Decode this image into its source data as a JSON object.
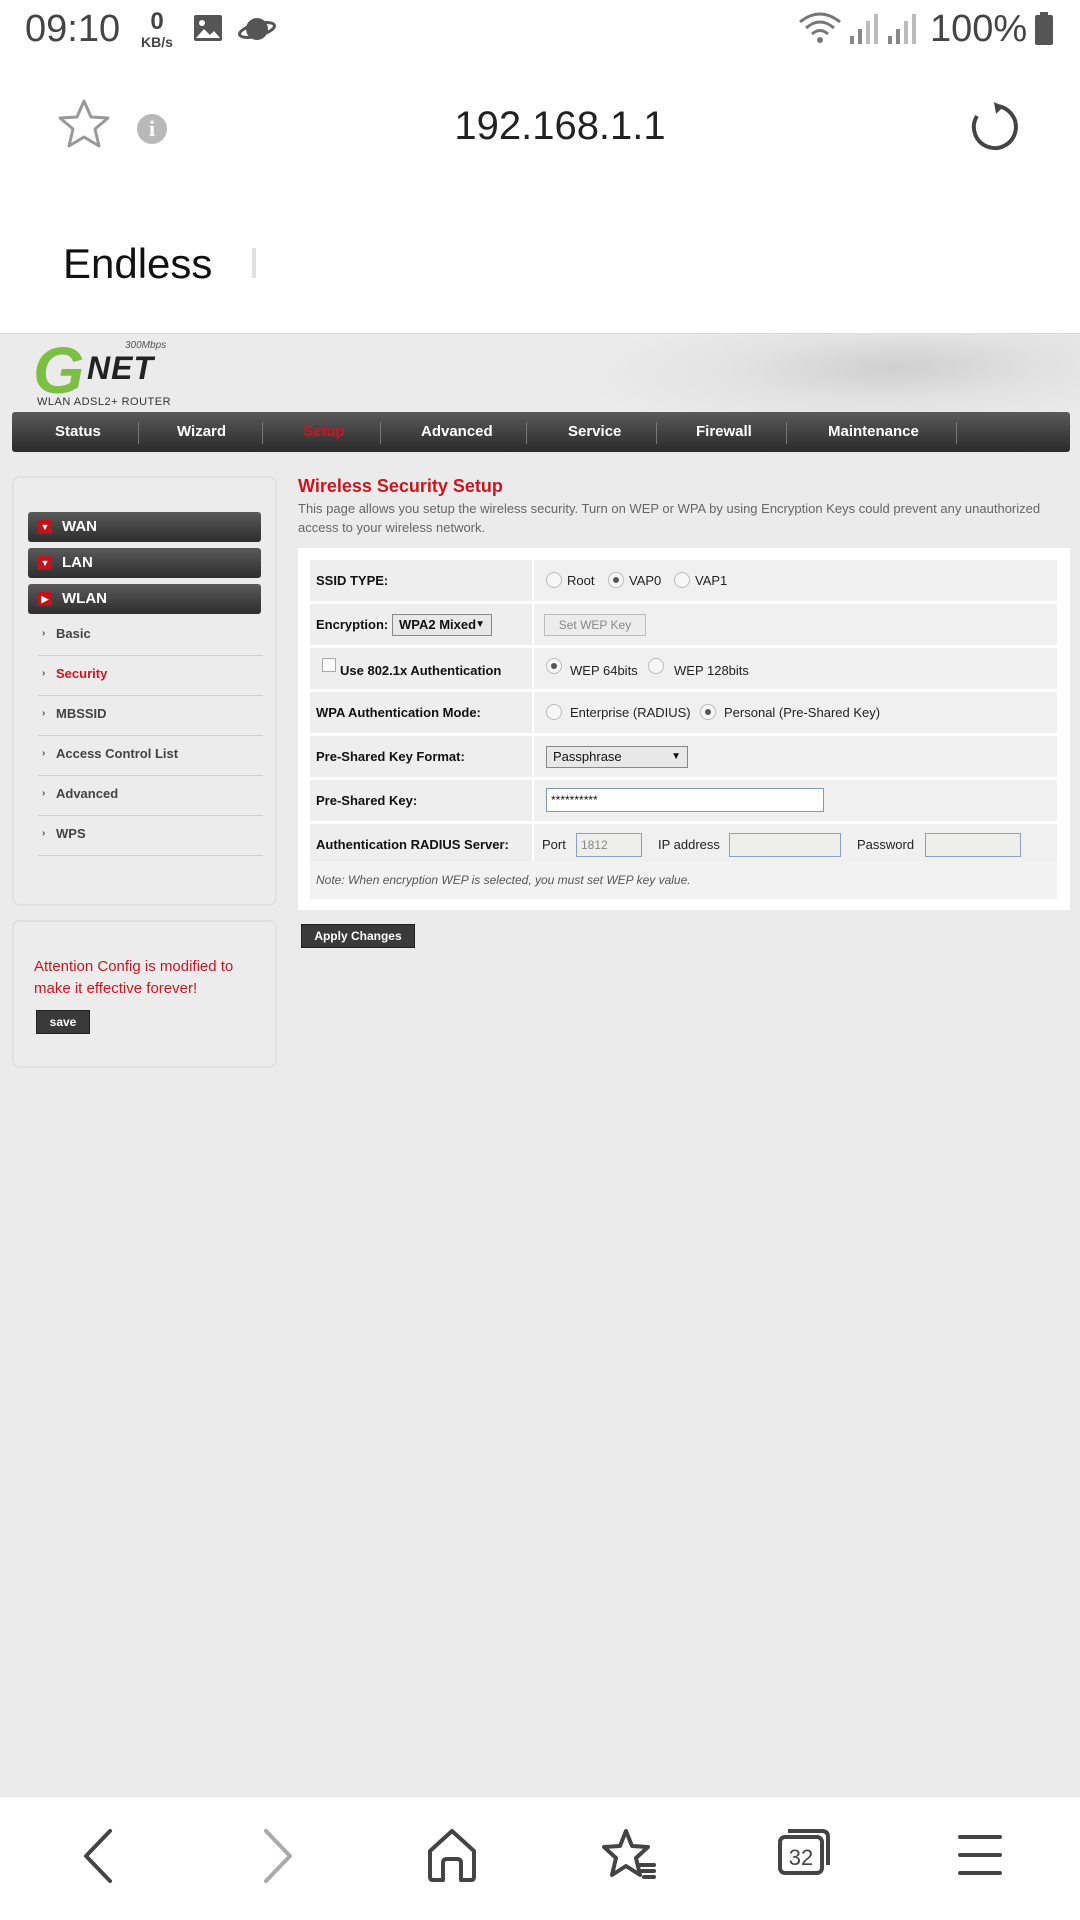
{
  "status_bar": {
    "time": "09:10",
    "speed_value": "0",
    "speed_unit": "KB/s",
    "battery": "100%"
  },
  "browser": {
    "url": "192.168.1.1",
    "page_text": "Endless",
    "tab_count": "32"
  },
  "router": {
    "logo": {
      "brand_g": "G",
      "brand_net": "NET",
      "speed": "300Mbps",
      "subtitle": "WLAN ADSL2+ ROUTER"
    },
    "nav": [
      {
        "label": "Status"
      },
      {
        "label": "Wizard"
      },
      {
        "label": "Setup"
      },
      {
        "label": "Advanced"
      },
      {
        "label": "Service"
      },
      {
        "label": "Firewall"
      },
      {
        "label": "Maintenance"
      }
    ],
    "sidebar": {
      "groups": [
        {
          "label": "WAN"
        },
        {
          "label": "LAN"
        },
        {
          "label": "WLAN"
        }
      ],
      "items": [
        {
          "label": "Basic"
        },
        {
          "label": "Security"
        },
        {
          "label": "MBSSID"
        },
        {
          "label": "Access Control List"
        },
        {
          "label": "Advanced"
        },
        {
          "label": "WPS"
        }
      ]
    },
    "attention": {
      "text": "Attention Config is modified to make it effective forever!",
      "save_label": "save"
    },
    "main": {
      "title": "Wireless Security Setup",
      "description": "This page allows you setup the wireless security. Turn on WEP or WPA by using Encryption Keys could prevent any unauthorized access to your wireless network.",
      "ssid_type": {
        "label": "SSID TYPE:",
        "options": [
          "Root",
          "VAP0",
          "VAP1"
        ],
        "selected": "VAP0"
      },
      "encryption": {
        "label": "Encryption:",
        "value": "WPA2 Mixed",
        "wep_button": "Set WEP Key"
      },
      "auth8021x": {
        "label": "Use 802.1x Authentication",
        "opt1": "WEP 64bits",
        "opt2": "WEP 128bits"
      },
      "wpa_mode": {
        "label": "WPA Authentication Mode:",
        "opt1": "Enterprise (RADIUS)",
        "opt2": "Personal (Pre-Shared Key)"
      },
      "psk_format": {
        "label": "Pre-Shared Key Format:",
        "value": "Passphrase"
      },
      "psk": {
        "label": "Pre-Shared Key:",
        "value": "**********"
      },
      "radius": {
        "label": "Authentication RADIUS Server:",
        "port_label": "Port",
        "port_value": "1812",
        "ip_label": "IP address",
        "password_label": "Password"
      },
      "note": "Note: When encryption WEP is selected, you must set WEP key value.",
      "apply_label": "Apply Changes"
    },
    "colors": {
      "accent": "#d0141e",
      "logo_green": "#7cc043"
    }
  }
}
